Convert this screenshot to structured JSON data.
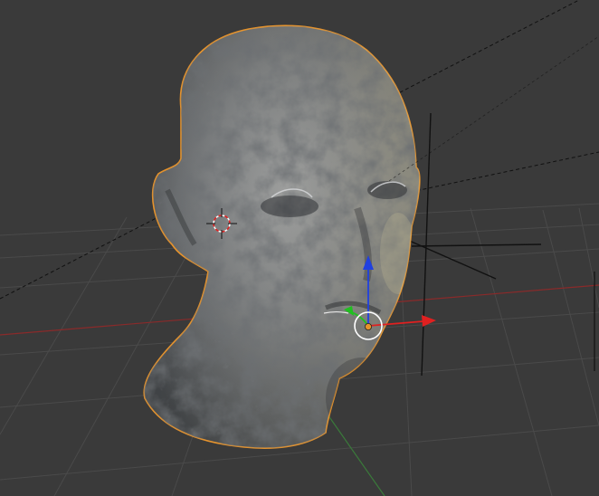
{
  "viewport": {
    "object_name": "head-mesh",
    "selected": true,
    "colors": {
      "background": "#3a3a3a",
      "grid": "#4a4a4a",
      "x_axis": "#8a2a2a",
      "y_axis": "#3a7a3a",
      "selection_outline": "#e8932a",
      "gizmo_x": "#e02020",
      "gizmo_y": "#20c020",
      "gizmo_z": "#2040e0",
      "mesh_base": "#6f7275",
      "mesh_dark": "#3e4144",
      "mesh_light": "#9a9c9e",
      "highlight": "#b8b29a"
    },
    "icons": [
      "3d-cursor-icon",
      "empty-axes-icon",
      "transform-gizmo-icon",
      "light-dashed-line"
    ]
  }
}
